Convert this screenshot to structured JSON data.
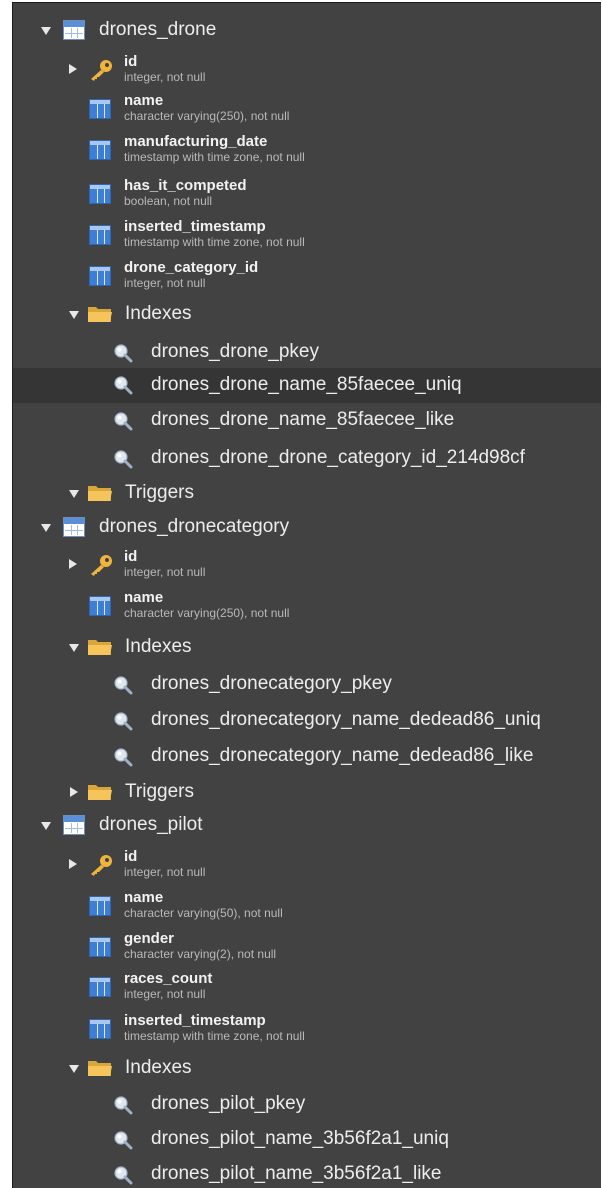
{
  "tree": {
    "drone": {
      "name": "drones_drone",
      "columns": [
        {
          "name": "id",
          "type": "integer, not null"
        },
        {
          "name": "name",
          "type": "character varying(250), not null"
        },
        {
          "name": "manufacturing_date",
          "type": "timestamp with time zone, not null"
        },
        {
          "name": "has_it_competed",
          "type": "boolean, not null"
        },
        {
          "name": "inserted_timestamp",
          "type": "timestamp with time zone, not null"
        },
        {
          "name": "drone_category_id",
          "type": "integer, not null"
        }
      ],
      "indexes_label": "Indexes",
      "indexes": [
        "drones_drone_pkey",
        "drones_drone_name_85faecee_uniq",
        "drones_drone_name_85faecee_like",
        "drones_drone_drone_category_id_214d98cf"
      ],
      "triggers_label": "Triggers"
    },
    "dronecategory": {
      "name": "drones_dronecategory",
      "columns": [
        {
          "name": "id",
          "type": "integer, not null"
        },
        {
          "name": "name",
          "type": "character varying(250), not null"
        }
      ],
      "indexes_label": "Indexes",
      "indexes": [
        "drones_dronecategory_pkey",
        "drones_dronecategory_name_dedead86_uniq",
        "drones_dronecategory_name_dedead86_like"
      ],
      "triggers_label": "Triggers"
    },
    "pilot": {
      "name": "drones_pilot",
      "columns": [
        {
          "name": "id",
          "type": "integer, not null"
        },
        {
          "name": "name",
          "type": "character varying(50), not null"
        },
        {
          "name": "gender",
          "type": "character varying(2), not null"
        },
        {
          "name": "races_count",
          "type": "integer, not null"
        },
        {
          "name": "inserted_timestamp",
          "type": "timestamp with time zone, not null"
        }
      ],
      "indexes_label": "Indexes",
      "indexes": [
        "drones_pilot_pkey",
        "drones_pilot_name_3b56f2a1_uniq",
        "drones_pilot_name_3b56f2a1_like"
      ]
    }
  },
  "colors": {
    "panel_bg": "#424242",
    "selected_row_bg": "#353535",
    "text": "#ededed",
    "type_text": "#b9b9b9",
    "key_icon": "#f0b43c",
    "folder_icon": "#f5c45a",
    "column_icon": "#3d7fd6"
  },
  "icons": [
    "table-icon",
    "key-icon",
    "column-icon",
    "folder-icon",
    "index-search-icon",
    "disclosure-triangle-icon"
  ]
}
